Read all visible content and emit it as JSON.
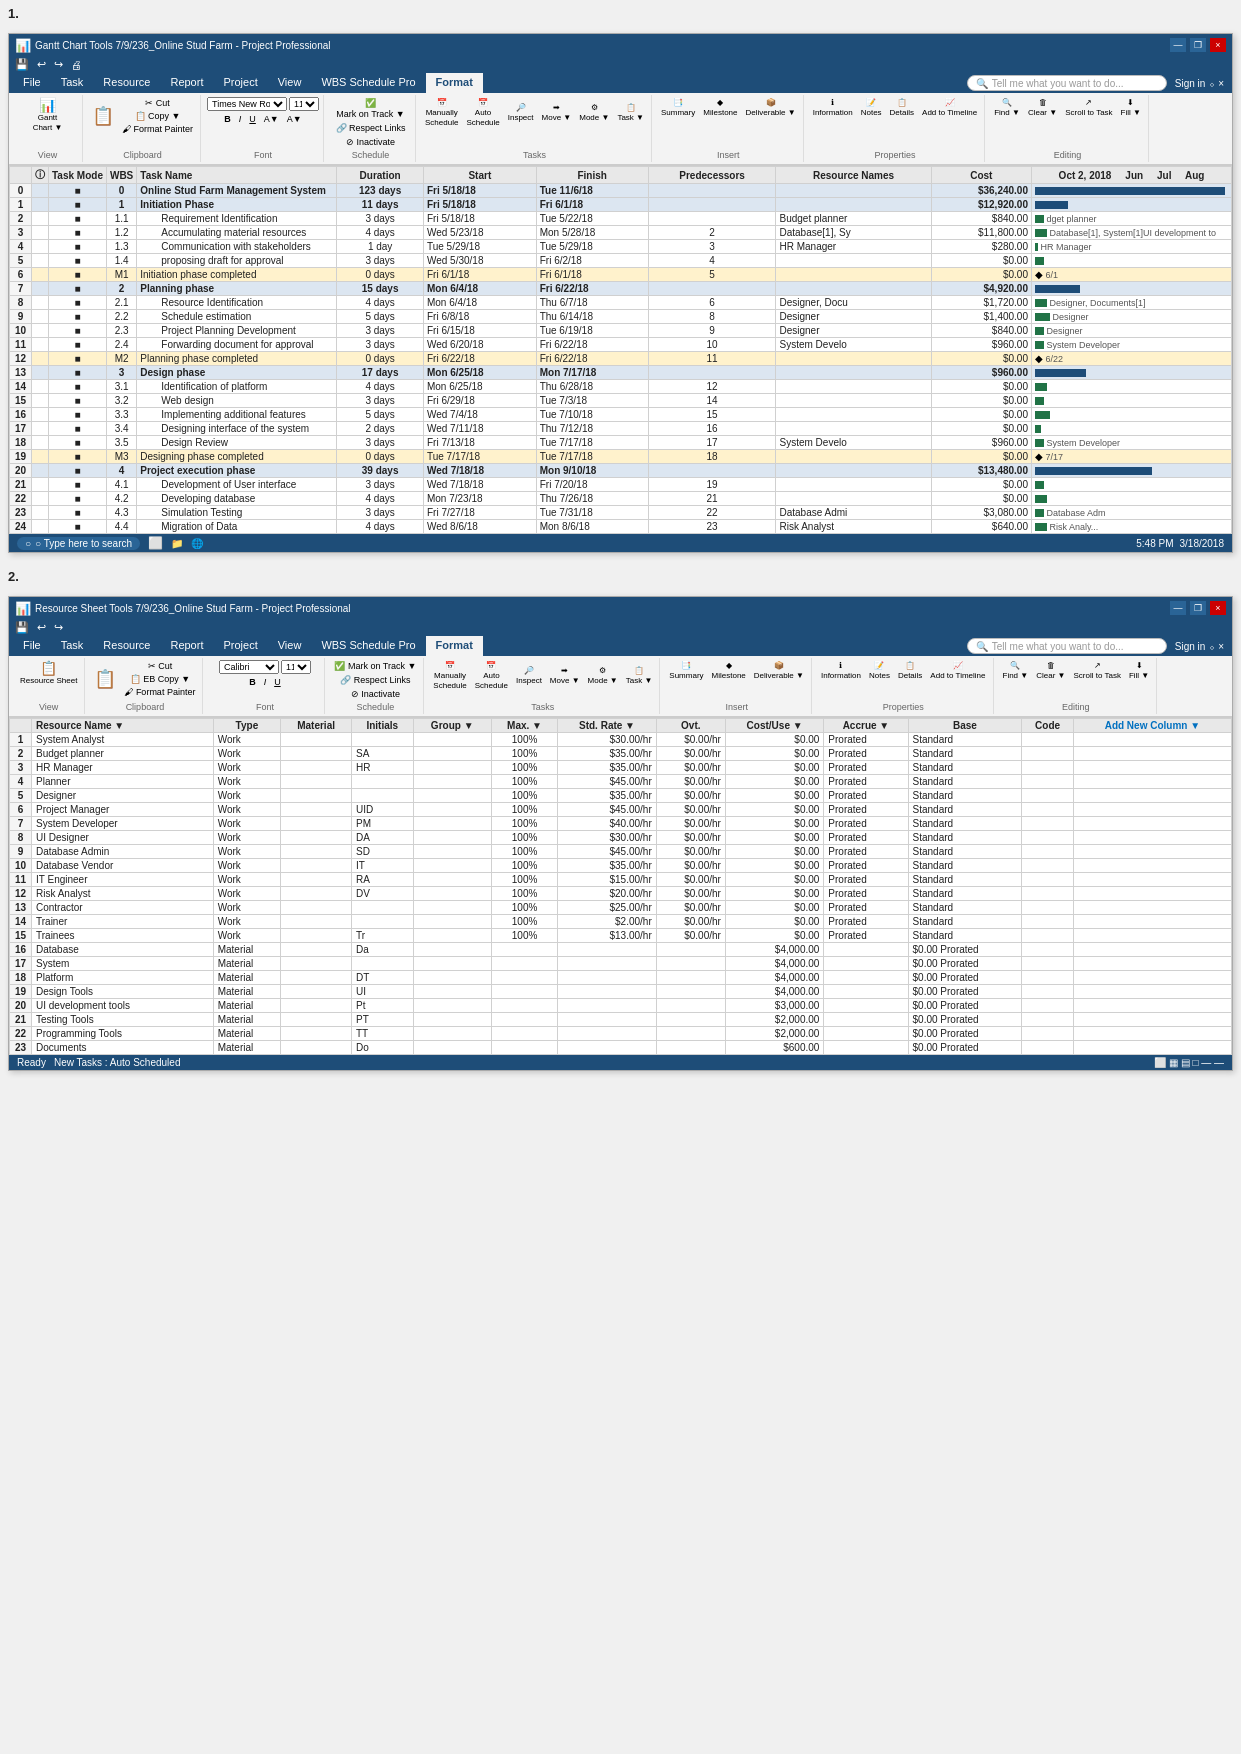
{
  "section1": {
    "label": "1.",
    "titleBar": {
      "title": "Gantt Chart Tools  7/9/236_Online Stud Farm - Project Professional",
      "buttons": [
        "—",
        "❐",
        "×"
      ]
    },
    "ribbonTabs": [
      "File",
      "Task",
      "Resource",
      "Report",
      "Project",
      "View",
      "WBS Schedule Pro",
      "Format"
    ],
    "activeTab": "Format",
    "quickAccessBtns": [
      "💾",
      "↩",
      "↪",
      "🖨"
    ],
    "tellMe": "Tell me what you want to do...",
    "signIn": "Sign in",
    "ribbonGroups": [
      {
        "label": "View",
        "buttons": [
          "Gantt Chart ▼"
        ]
      },
      {
        "label": "Clipboard",
        "buttons": [
          "Paste",
          "✂ Cut",
          "📋 Copy ▼",
          "Format Painter"
        ]
      },
      {
        "label": "Font",
        "buttons": [
          "Times New Ro",
          "11",
          "B",
          "I",
          "U",
          "A▼",
          "A▼"
        ]
      },
      {
        "label": "Schedule",
        "buttons": [
          "Mark on Track ▼",
          "Respect Links",
          "Inactivate"
        ]
      },
      {
        "label": "Tasks",
        "buttons": [
          "Manually Schedule",
          "Auto Schedule",
          "Inspect",
          "Move ▼",
          "Mode ▼",
          "Task ▼"
        ]
      },
      {
        "label": "Insert",
        "buttons": [
          "Summary",
          "Milestone",
          "Deliverable ▼"
        ]
      },
      {
        "label": "Properties",
        "buttons": [
          "Notes",
          "Details",
          "Add to Timeline",
          "Information"
        ]
      },
      {
        "label": "Editing",
        "buttons": [
          "Find ▼",
          "Clear ▼",
          "Scroll to Task",
          "Fill ▼"
        ]
      }
    ],
    "columnHeaders": [
      "",
      "ⓘ",
      "Task Mode",
      "WBS",
      "Task Name",
      "Duration",
      "Start",
      "Finish",
      "Predecessors",
      "Resource Names",
      "Cost",
      "Oct 2, 2018 Jun",
      "Jul",
      "Aug"
    ],
    "rows": [
      {
        "num": "0",
        "mode": "■",
        "wbs": "0",
        "name": "Online Stud Farm Management System",
        "duration": "123 days",
        "start": "Fri 5/18/18",
        "finish": "Tue 11/6/18",
        "pred": "",
        "resource": "",
        "cost": "$36,240.00",
        "type": "summary"
      },
      {
        "num": "1",
        "mode": "■",
        "wbs": "1",
        "name": "Initiation Phase",
        "duration": "11 days",
        "start": "Fri 5/18/18",
        "finish": "Fri 6/1/18",
        "pred": "",
        "resource": "",
        "cost": "$12,920.00",
        "type": "phase"
      },
      {
        "num": "2",
        "mode": "■",
        "wbs": "1.1",
        "name": "Requirement Identification",
        "duration": "3 days",
        "start": "Fri 5/18/18",
        "finish": "Tue 5/22/18",
        "pred": "",
        "resource": "Budget planner",
        "cost": "$840.00",
        "type": "normal",
        "note": "dget planner"
      },
      {
        "num": "3",
        "mode": "■",
        "wbs": "1.2",
        "name": "Accumulating material resources",
        "duration": "4 days",
        "start": "Wed 5/23/18",
        "finish": "Mon 5/28/18",
        "pred": "2",
        "resource": "Database[1], Sy",
        "cost": "$11,800.00",
        "type": "normal",
        "note": "Database[1], System[1]UI development to"
      },
      {
        "num": "4",
        "mode": "■",
        "wbs": "1.3",
        "name": "Communication with stakeholders",
        "duration": "1 day",
        "start": "Tue 5/29/18",
        "finish": "Tue 5/29/18",
        "pred": "3",
        "resource": "HR Manager",
        "cost": "$280.00",
        "type": "normal",
        "note": "HR Manager"
      },
      {
        "num": "5",
        "mode": "■",
        "wbs": "1.4",
        "name": "proposing draft for approval",
        "duration": "3 days",
        "start": "Wed 5/30/18",
        "finish": "Fri 6/2/18",
        "pred": "4",
        "resource": "",
        "cost": "$0.00",
        "type": "normal"
      },
      {
        "num": "6",
        "mode": "■",
        "wbs": "M1",
        "name": "Initiation phase completed",
        "duration": "0 days",
        "start": "Fri 6/1/18",
        "finish": "Fri 6/1/18",
        "pred": "5",
        "resource": "",
        "cost": "$0.00",
        "type": "milestone",
        "note": "6/1"
      },
      {
        "num": "7",
        "mode": "■",
        "wbs": "2",
        "name": "Planning phase",
        "duration": "15 days",
        "start": "Mon 6/4/18",
        "finish": "Fri 6/22/18",
        "pred": "",
        "resource": "",
        "cost": "$4,920.00",
        "type": "phase"
      },
      {
        "num": "8",
        "mode": "■",
        "wbs": "2.1",
        "name": "Resource Identification",
        "duration": "4 days",
        "start": "Mon 6/4/18",
        "finish": "Thu 6/7/18",
        "pred": "6",
        "resource": "Designer, Docu",
        "cost": "$1,720.00",
        "type": "normal",
        "note": "Designer, Documents[1]"
      },
      {
        "num": "9",
        "mode": "■",
        "wbs": "2.2",
        "name": "Schedule estimation",
        "duration": "5 days",
        "start": "Fri 6/8/18",
        "finish": "Thu 6/14/18",
        "pred": "8",
        "resource": "Designer",
        "cost": "$1,400.00",
        "type": "normal",
        "note": "Designer"
      },
      {
        "num": "10",
        "mode": "■",
        "wbs": "2.3",
        "name": "Project Planning Development",
        "duration": "3 days",
        "start": "Fri 6/15/18",
        "finish": "Tue 6/19/18",
        "pred": "9",
        "resource": "Designer",
        "cost": "$840.00",
        "type": "normal",
        "note": "Designer"
      },
      {
        "num": "11",
        "mode": "■",
        "wbs": "2.4",
        "name": "Forwarding document for approval",
        "duration": "3 days",
        "start": "Wed 6/20/18",
        "finish": "Fri 6/22/18",
        "pred": "10",
        "resource": "System Develo",
        "cost": "$960.00",
        "type": "normal",
        "note": "System Developer"
      },
      {
        "num": "12",
        "mode": "■",
        "wbs": "M2",
        "name": "Planning phase completed",
        "duration": "0 days",
        "start": "Fri 6/22/18",
        "finish": "Fri 6/22/18",
        "pred": "11",
        "resource": "",
        "cost": "$0.00",
        "type": "milestone",
        "note": "6/22"
      },
      {
        "num": "13",
        "mode": "■",
        "wbs": "3",
        "name": "Design phase",
        "duration": "17 days",
        "start": "Mon 6/25/18",
        "finish": "Mon 7/17/18",
        "pred": "",
        "resource": "",
        "cost": "$960.00",
        "type": "phase"
      },
      {
        "num": "14",
        "mode": "■",
        "wbs": "3.1",
        "name": "Identification of platform",
        "duration": "4 days",
        "start": "Mon 6/25/18",
        "finish": "Thu 6/28/18",
        "pred": "12",
        "resource": "",
        "cost": "$0.00",
        "type": "normal"
      },
      {
        "num": "15",
        "mode": "■",
        "wbs": "3.2",
        "name": "Web design",
        "duration": "3 days",
        "start": "Fri 6/29/18",
        "finish": "Tue 7/3/18",
        "pred": "14",
        "resource": "",
        "cost": "$0.00",
        "type": "normal"
      },
      {
        "num": "16",
        "mode": "■",
        "wbs": "3.3",
        "name": "Implementing additional features",
        "duration": "5 days",
        "start": "Wed 7/4/18",
        "finish": "Tue 7/10/18",
        "pred": "15",
        "resource": "",
        "cost": "$0.00",
        "type": "normal"
      },
      {
        "num": "17",
        "mode": "■",
        "wbs": "3.4",
        "name": "Designing interface of the system",
        "duration": "2 days",
        "start": "Wed 7/11/18",
        "finish": "Thu 7/12/18",
        "pred": "16",
        "resource": "",
        "cost": "$0.00",
        "type": "normal"
      },
      {
        "num": "18",
        "mode": "■",
        "wbs": "3.5",
        "name": "Design Review",
        "duration": "3 days",
        "start": "Fri 7/13/18",
        "finish": "Tue 7/17/18",
        "pred": "17",
        "resource": "System Develo",
        "cost": "$960.00",
        "type": "normal",
        "note": "System Developer"
      },
      {
        "num": "19",
        "mode": "■",
        "wbs": "M3",
        "name": "Designing phase completed",
        "duration": "0 days",
        "start": "Tue 7/17/18",
        "finish": "Tue 7/17/18",
        "pred": "18",
        "resource": "",
        "cost": "$0.00",
        "type": "milestone",
        "note": "7/17"
      },
      {
        "num": "20",
        "mode": "■",
        "wbs": "4",
        "name": "Project execution phase",
        "duration": "39 days",
        "start": "Wed 7/18/18",
        "finish": "Mon 9/10/18",
        "pred": "",
        "resource": "",
        "cost": "$13,480.00",
        "type": "phase"
      },
      {
        "num": "21",
        "mode": "■",
        "wbs": "4.1",
        "name": "Development of User interface",
        "duration": "3 days",
        "start": "Wed 7/18/18",
        "finish": "Fri 7/20/18",
        "pred": "19",
        "resource": "",
        "cost": "$0.00",
        "type": "normal"
      },
      {
        "num": "22",
        "mode": "■",
        "wbs": "4.2",
        "name": "Developing database",
        "duration": "4 days",
        "start": "Mon 7/23/18",
        "finish": "Thu 7/26/18",
        "pred": "21",
        "resource": "",
        "cost": "$0.00",
        "type": "normal"
      },
      {
        "num": "23",
        "mode": "■",
        "wbs": "4.3",
        "name": "Simulation Testing",
        "duration": "3 days",
        "start": "Fri 7/27/18",
        "finish": "Tue 7/31/18",
        "pred": "22",
        "resource": "Database Admi",
        "cost": "$3,080.00",
        "type": "normal",
        "note": "Database Adm"
      },
      {
        "num": "24",
        "mode": "■",
        "wbs": "4.4",
        "name": "Migration of Data",
        "duration": "4 days",
        "start": "Wed 8/6/18",
        "finish": "Mon 8/6/18",
        "pred": "23",
        "resource": "Risk Analyst",
        "cost": "$640.00",
        "type": "normal",
        "note": "Risk Analy..."
      }
    ],
    "statusBar": {
      "text": "○ Type here to search",
      "rightItems": [
        "5:48 PM",
        "3/18/2018"
      ]
    }
  },
  "section2": {
    "label": "2.",
    "titleBar": {
      "title": "Resource Sheet Tools  7/9/236_Online Stud Farm - Project Professional",
      "buttons": [
        "—",
        "❐",
        "×"
      ]
    },
    "ribbonTabs": [
      "File",
      "Task",
      "Resource",
      "Report",
      "Project",
      "View",
      "WBS Schedule Pro",
      "Format"
    ],
    "activeTab": "Format",
    "tellMe": "Tell me what you want to do...",
    "signIn": "Sign in",
    "columnHeaders": [
      "",
      "Resource Name",
      "Type",
      "Material",
      "Initials",
      "Group",
      "Max.",
      "Std. Rate",
      "Ovt.",
      "Cost/Use",
      "Accrue",
      "Base",
      "Code",
      "Add New Column"
    ],
    "rows": [
      {
        "num": "1",
        "name": "System Analyst",
        "type": "Work",
        "material": "",
        "initials": "",
        "group": "",
        "max": "100%",
        "stdRate": "$30.00/hr",
        "ovt": "$0.00/hr",
        "costUse": "$0.00",
        "accrue": "Prorated",
        "base": "Standard"
      },
      {
        "num": "2",
        "name": "Budget planner",
        "type": "Work",
        "material": "",
        "initials": "SA",
        "group": "",
        "max": "100%",
        "stdRate": "$35.00/hr",
        "ovt": "$0.00/hr",
        "costUse": "$0.00",
        "accrue": "Prorated",
        "base": "Standard"
      },
      {
        "num": "3",
        "name": "HR Manager",
        "type": "Work",
        "material": "",
        "initials": "HR",
        "group": "",
        "max": "100%",
        "stdRate": "$35.00/hr",
        "ovt": "$0.00/hr",
        "costUse": "$0.00",
        "accrue": "Prorated",
        "base": "Standard"
      },
      {
        "num": "4",
        "name": "Planner",
        "type": "Work",
        "material": "",
        "initials": "",
        "group": "",
        "max": "100%",
        "stdRate": "$45.00/hr",
        "ovt": "$0.00/hr",
        "costUse": "$0.00",
        "accrue": "Prorated",
        "base": "Standard"
      },
      {
        "num": "5",
        "name": "Designer",
        "type": "Work",
        "material": "",
        "initials": "",
        "group": "",
        "max": "100%",
        "stdRate": "$35.00/hr",
        "ovt": "$0.00/hr",
        "costUse": "$0.00",
        "accrue": "Prorated",
        "base": "Standard"
      },
      {
        "num": "6",
        "name": "Project Manager",
        "type": "Work",
        "material": "",
        "initials": "UID",
        "group": "",
        "max": "100%",
        "stdRate": "$45.00/hr",
        "ovt": "$0.00/hr",
        "costUse": "$0.00",
        "accrue": "Prorated",
        "base": "Standard"
      },
      {
        "num": "7",
        "name": "System Developer",
        "type": "Work",
        "material": "",
        "initials": "PM",
        "group": "",
        "max": "100%",
        "stdRate": "$40.00/hr",
        "ovt": "$0.00/hr",
        "costUse": "$0.00",
        "accrue": "Prorated",
        "base": "Standard"
      },
      {
        "num": "8",
        "name": "UI Designer",
        "type": "Work",
        "material": "",
        "initials": "DA",
        "group": "",
        "max": "100%",
        "stdRate": "$30.00/hr",
        "ovt": "$0.00/hr",
        "costUse": "$0.00",
        "accrue": "Prorated",
        "base": "Standard"
      },
      {
        "num": "9",
        "name": "Database Admin",
        "type": "Work",
        "material": "",
        "initials": "SD",
        "group": "",
        "max": "100%",
        "stdRate": "$45.00/hr",
        "ovt": "$0.00/hr",
        "costUse": "$0.00",
        "accrue": "Prorated",
        "base": "Standard"
      },
      {
        "num": "10",
        "name": "Database Vendor",
        "type": "Work",
        "material": "",
        "initials": "IT",
        "group": "",
        "max": "100%",
        "stdRate": "$35.00/hr",
        "ovt": "$0.00/hr",
        "costUse": "$0.00",
        "accrue": "Prorated",
        "base": "Standard"
      },
      {
        "num": "11",
        "name": "IT Engineer",
        "type": "Work",
        "material": "",
        "initials": "RA",
        "group": "",
        "max": "100%",
        "stdRate": "$15.00/hr",
        "ovt": "$0.00/hr",
        "costUse": "$0.00",
        "accrue": "Prorated",
        "base": "Standard"
      },
      {
        "num": "12",
        "name": "Risk Analyst",
        "type": "Work",
        "material": "",
        "initials": "DV",
        "group": "",
        "max": "100%",
        "stdRate": "$20.00/hr",
        "ovt": "$0.00/hr",
        "costUse": "$0.00",
        "accrue": "Prorated",
        "base": "Standard"
      },
      {
        "num": "13",
        "name": "Contractor",
        "type": "Work",
        "material": "",
        "initials": "",
        "group": "",
        "max": "100%",
        "stdRate": "$25.00/hr",
        "ovt": "$0.00/hr",
        "costUse": "$0.00",
        "accrue": "Prorated",
        "base": "Standard"
      },
      {
        "num": "14",
        "name": "Trainer",
        "type": "Work",
        "material": "",
        "initials": "",
        "group": "",
        "max": "100%",
        "stdRate": "$2.00/hr",
        "ovt": "$0.00/hr",
        "costUse": "$0.00",
        "accrue": "Prorated",
        "base": "Standard"
      },
      {
        "num": "15",
        "name": "Trainees",
        "type": "Work",
        "material": "",
        "initials": "Tr",
        "group": "",
        "max": "100%",
        "stdRate": "$13.00/hr",
        "ovt": "$0.00/hr",
        "costUse": "$0.00",
        "accrue": "Prorated",
        "base": "Standard"
      },
      {
        "num": "16",
        "name": "Database",
        "type": "Material",
        "material": "",
        "initials": "Da",
        "group": "",
        "max": "",
        "stdRate": "",
        "ovt": "",
        "costUse": "$4,000.00",
        "accrue": "",
        "base": "$0.00 Prorated"
      },
      {
        "num": "17",
        "name": "System",
        "type": "Material",
        "material": "",
        "initials": "",
        "group": "",
        "max": "",
        "stdRate": "",
        "ovt": "",
        "costUse": "$4,000.00",
        "accrue": "",
        "base": "$0.00 Prorated"
      },
      {
        "num": "18",
        "name": "Platform",
        "type": "Material",
        "material": "",
        "initials": "DT",
        "group": "",
        "max": "",
        "stdRate": "",
        "ovt": "",
        "costUse": "$4,000.00",
        "accrue": "",
        "base": "$0.00 Prorated"
      },
      {
        "num": "19",
        "name": "Design Tools",
        "type": "Material",
        "material": "",
        "initials": "UI",
        "group": "",
        "max": "",
        "stdRate": "",
        "ovt": "",
        "costUse": "$4,000.00",
        "accrue": "",
        "base": "$0.00 Prorated"
      },
      {
        "num": "20",
        "name": "UI development tools",
        "type": "Material",
        "material": "",
        "initials": "Pt",
        "group": "",
        "max": "",
        "stdRate": "",
        "ovt": "",
        "costUse": "$3,000.00",
        "accrue": "",
        "base": "$0.00 Prorated"
      },
      {
        "num": "21",
        "name": "Testing Tools",
        "type": "Material",
        "material": "",
        "initials": "PT",
        "group": "",
        "max": "",
        "stdRate": "",
        "ovt": "",
        "costUse": "$2,000.00",
        "accrue": "",
        "base": "$0.00 Prorated"
      },
      {
        "num": "22",
        "name": "Programming Tools",
        "type": "Material",
        "material": "",
        "initials": "TT",
        "group": "",
        "max": "",
        "stdRate": "",
        "ovt": "",
        "costUse": "$2,000.00",
        "accrue": "",
        "base": "$0.00 Prorated"
      },
      {
        "num": "23",
        "name": "Documents",
        "type": "Material",
        "material": "",
        "initials": "Do",
        "group": "",
        "max": "",
        "stdRate": "",
        "ovt": "",
        "costUse": "$600.00",
        "accrue": "",
        "base": "$0.00 Prorated"
      }
    ],
    "statusBar": {
      "text": "Ready",
      "rightItems": [
        "New Tasks : Auto Scheduled"
      ]
    }
  }
}
